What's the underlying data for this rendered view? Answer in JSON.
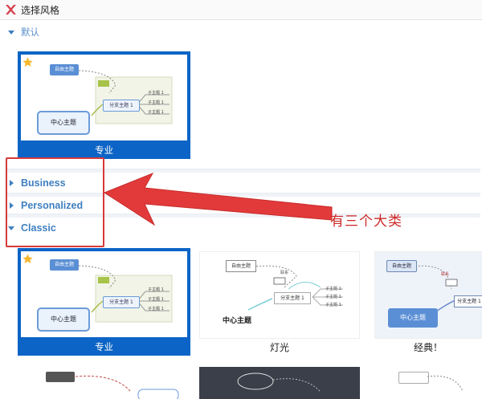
{
  "window": {
    "title": "选择风格",
    "logo_icon": "x-logo-icon",
    "accent": "#d6434e"
  },
  "sections": {
    "default": {
      "label": "默认"
    },
    "business": {
      "label": "Business"
    },
    "personalized": {
      "label": "Personalized"
    },
    "classic": {
      "label": "Classic"
    }
  },
  "default_cards": [
    {
      "caption": "专业",
      "selected": true,
      "starred": true,
      "nodes": {
        "central": "中心主题",
        "topic": "分支主题 1",
        "sub": "子主题 1",
        "float": "自由主题"
      }
    }
  ],
  "classic_cards": [
    {
      "caption": "专业",
      "selected": true,
      "starred": true,
      "nodes": {
        "central": "中心主题",
        "topic": "分支主题 1",
        "sub": "子主题 1",
        "float": "自由主题"
      }
    },
    {
      "caption": "灯光",
      "selected": false,
      "nodes": {
        "central": "中心主题",
        "topic": "分支主题 1",
        "sub": "子主题 1",
        "float": "自由主题",
        "note": "联系"
      }
    },
    {
      "caption": "经典！",
      "selected": false,
      "nodes": {
        "central": "中心主题",
        "topic": "分支主题 1",
        "float": "自由主题",
        "note": "联系"
      }
    }
  ],
  "annotation": {
    "text": "有三个大类",
    "color": "#cc2626"
  },
  "colors": {
    "selected_bg": "#0c64c6",
    "section_text": "#3f7fc0",
    "highlight": "#d63a3a"
  }
}
